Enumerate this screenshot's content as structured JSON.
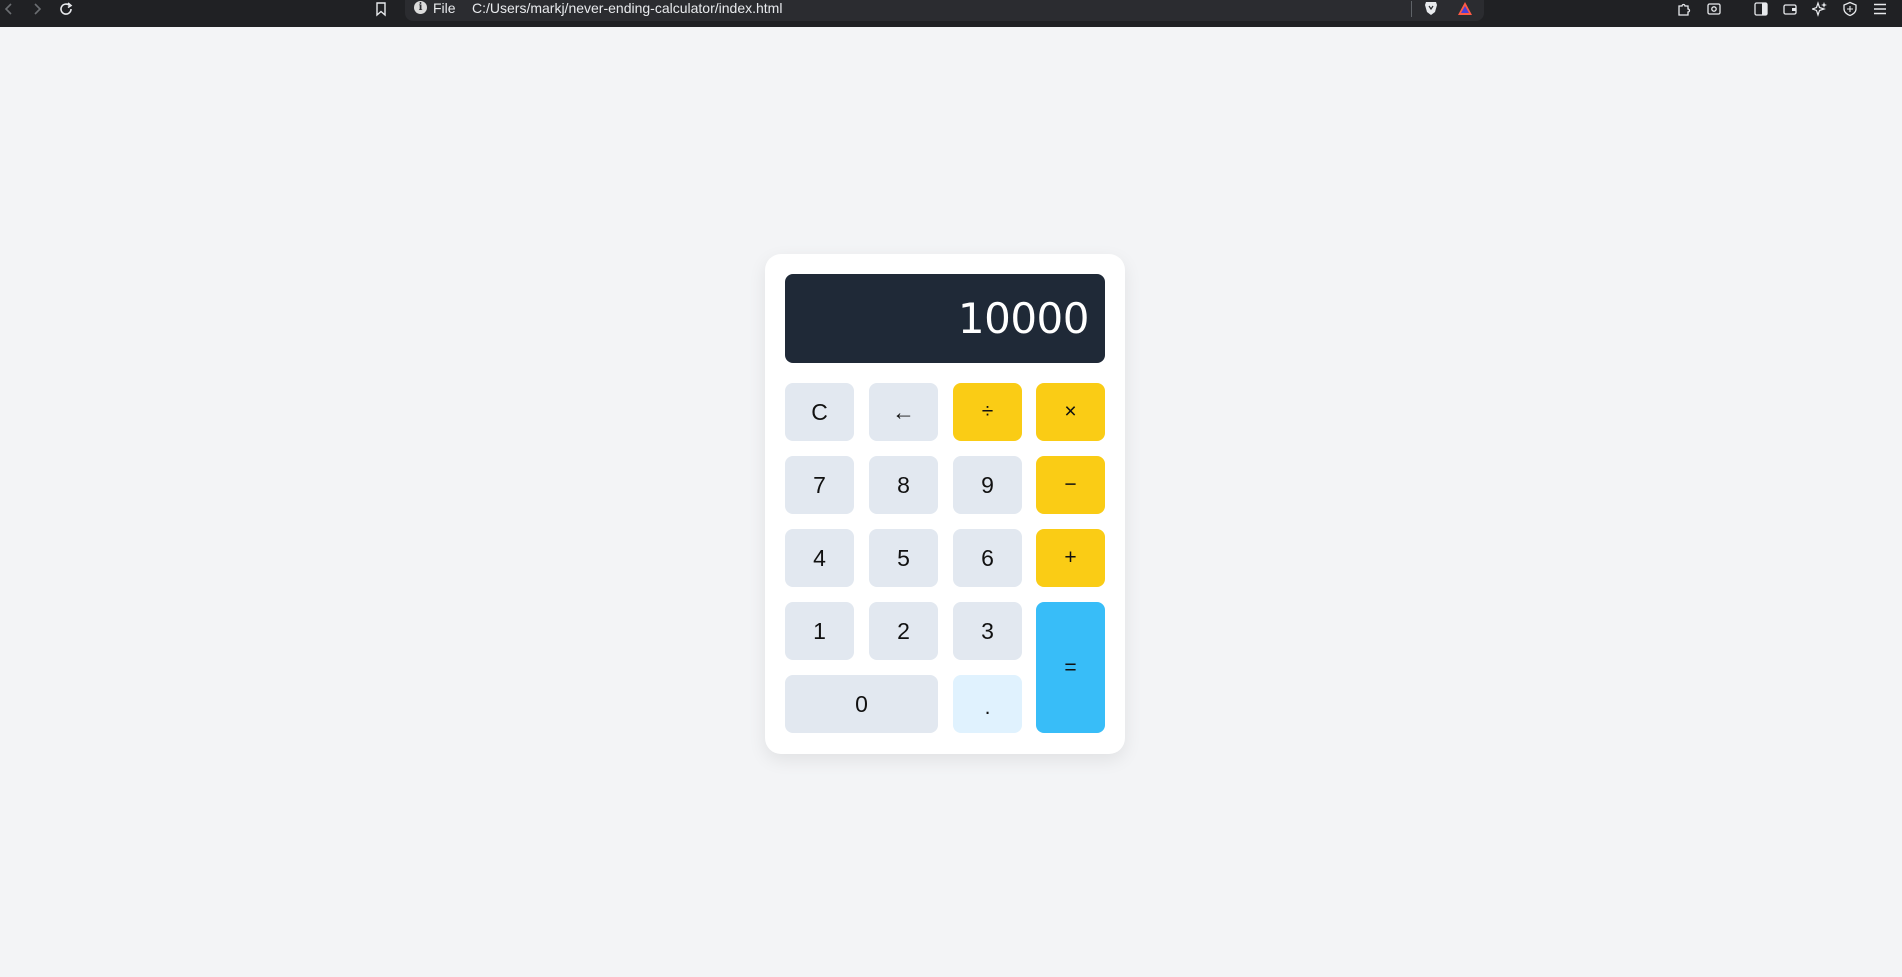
{
  "browser": {
    "url_scheme_label": "File",
    "url": "C:/Users/markj/never-ending-calculator/index.html",
    "icons": [
      "back-icon",
      "forward-icon",
      "reload-icon",
      "bookmark-icon",
      "info-icon",
      "brave-shield-icon",
      "brave-rewards-icon",
      "extensions-icon",
      "screenshot-icon",
      "sidebar-icon",
      "wallet-icon",
      "leo-ai-icon",
      "vpn-icon",
      "menu-icon"
    ]
  },
  "calculator": {
    "display_value": "10000",
    "keys": {
      "clear": "C",
      "backspace": "←",
      "divide": "÷",
      "multiply": "×",
      "seven": "7",
      "eight": "8",
      "nine": "9",
      "subtract": "−",
      "four": "4",
      "five": "5",
      "six": "6",
      "add": "+",
      "one": "1",
      "two": "2",
      "three": "3",
      "equals": "=",
      "zero": "0",
      "decimal": "."
    }
  },
  "colors": {
    "page_background": "#f3f4f6",
    "display_background": "#1f2937",
    "number_key": "#e2e8f0",
    "operator_key": "#facc15",
    "equals_key": "#38bdf8",
    "decimal_key": "#e0f2fe"
  }
}
